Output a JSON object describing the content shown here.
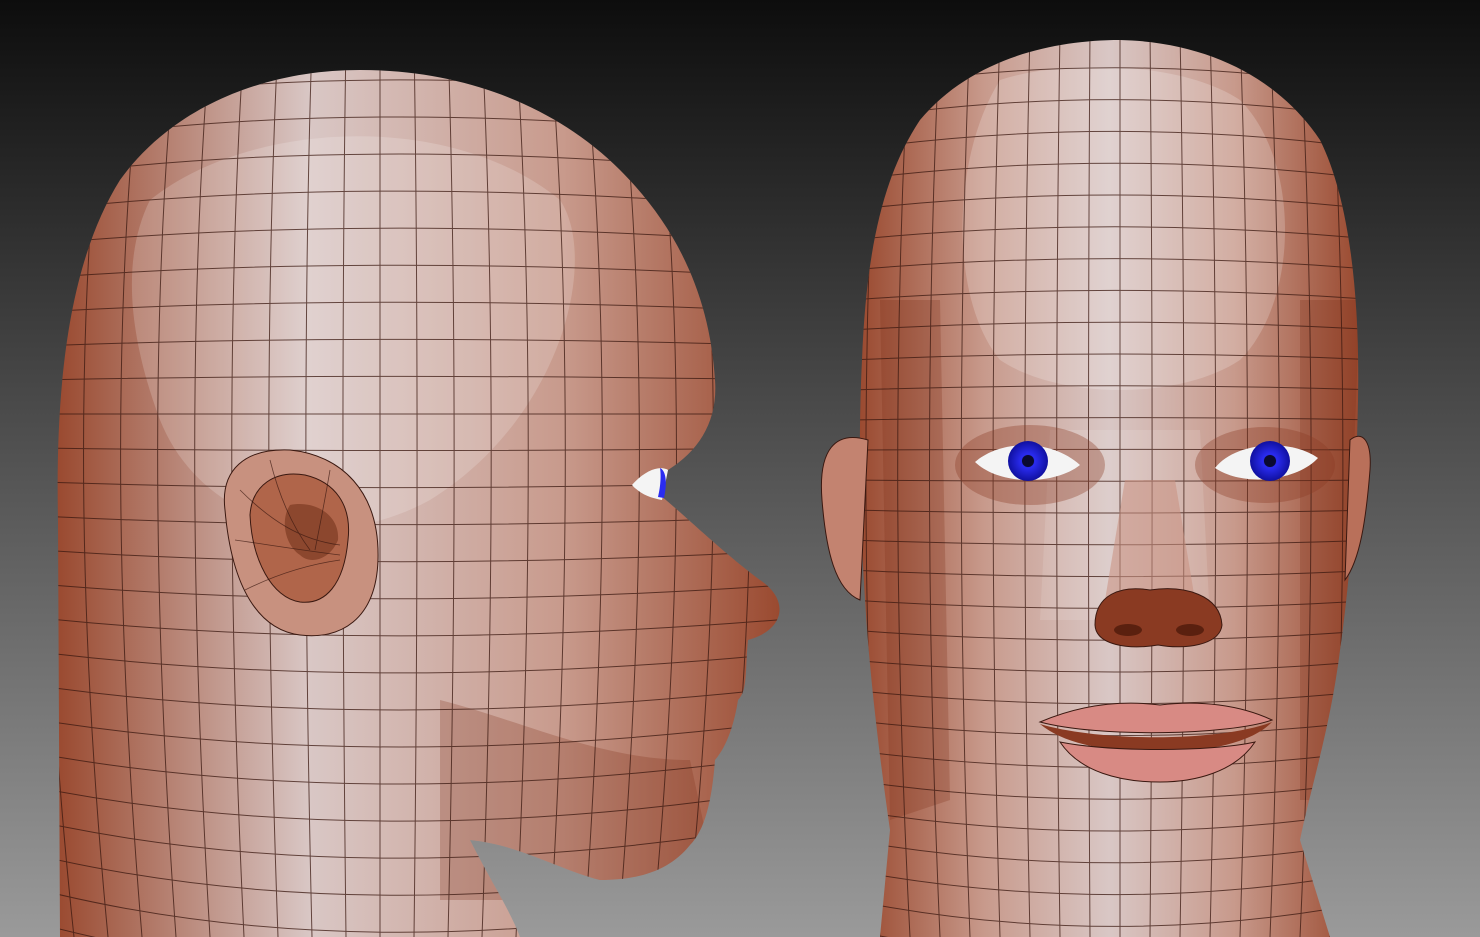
{
  "scene": {
    "background_top": "#0d0d0d",
    "background_bottom": "#9a9a9a",
    "skin_light": "#d9c7c5",
    "skin_mid": "#c89a8c",
    "skin_dark": "#9a4a30",
    "wire_color": "#3a1810",
    "iris_color": "#2a2cf0",
    "sclera_color": "#f4f4f4",
    "lip_color": "#d88a84"
  },
  "models": [
    {
      "view": "side-profile"
    },
    {
      "view": "front"
    }
  ]
}
